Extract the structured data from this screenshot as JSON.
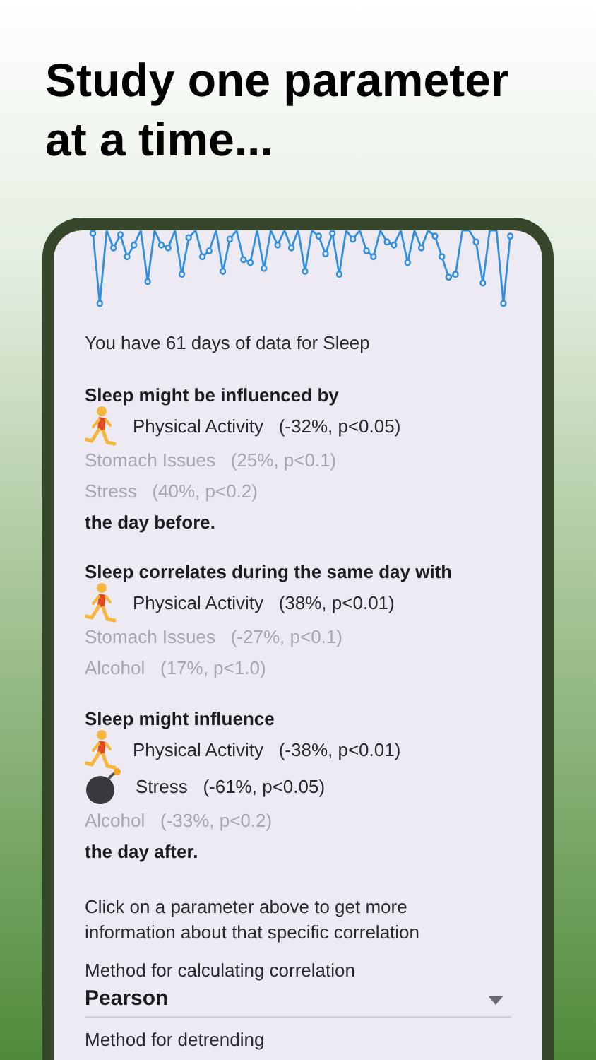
{
  "headline": "Study one parameter at a time...",
  "summary": "You have 61 days of data for Sleep",
  "sections": [
    {
      "heading": "Sleep might be influenced by",
      "footer": "the day before.",
      "items": [
        {
          "kind": "runner",
          "name": "Physical Activity",
          "stats": "(-32%, p<0.05)"
        },
        {
          "kind": "plain",
          "name": "Stomach Issues",
          "stats": "(25%, p<0.1)"
        },
        {
          "kind": "plain",
          "name": "Stress",
          "stats": "(40%, p<0.2)"
        }
      ]
    },
    {
      "heading": "Sleep correlates during the same day with",
      "items": [
        {
          "kind": "runner",
          "name": "Physical Activity",
          "stats": "(38%, p<0.01)"
        },
        {
          "kind": "plain",
          "name": "Stomach Issues",
          "stats": "(-27%, p<0.1)"
        },
        {
          "kind": "plain",
          "name": "Alcohol",
          "stats": "(17%, p<1.0)"
        }
      ]
    },
    {
      "heading": "Sleep might influence",
      "footer": "the day after.",
      "items": [
        {
          "kind": "runner",
          "name": "Physical Activity",
          "stats": "(-38%, p<0.01)"
        },
        {
          "kind": "bomb",
          "name": "Stress",
          "stats": "(-61%, p<0.05)"
        },
        {
          "kind": "plain",
          "name": "Alcohol",
          "stats": "(-33%, p<0.2)"
        }
      ]
    }
  ],
  "hint": "Click on a parameter above to get more information about that specific correlation",
  "method": {
    "label": "Method for calculating correlation",
    "value": "Pearson"
  },
  "detrending": {
    "label": "Method for detrending"
  }
}
